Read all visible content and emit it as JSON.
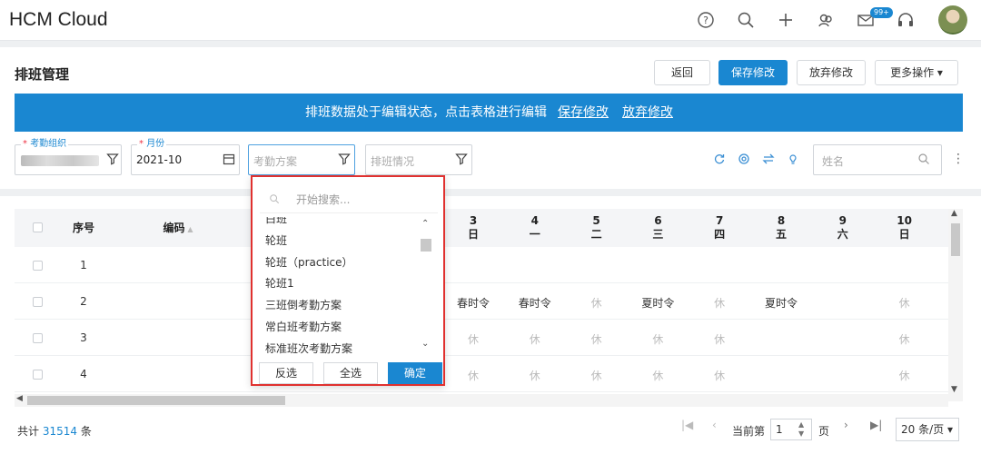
{
  "app": {
    "title": "HCM Cloud",
    "notification_badge": "99+"
  },
  "page": {
    "title": "排班管理"
  },
  "toolbar": {
    "back": "返回",
    "save": "保存修改",
    "discard": "放弃修改",
    "more": "更多操作 ▾"
  },
  "banner": {
    "message": "排班数据处于编辑状态，点击表格进行编辑",
    "save_link": "保存修改",
    "discard_link": "放弃修改"
  },
  "filters": {
    "org": {
      "label": "考勤组织",
      "value": ""
    },
    "month": {
      "label": "月份",
      "value": "2021-10"
    },
    "plan": {
      "placeholder": "考勤方案"
    },
    "status": {
      "placeholder": "排班情况"
    },
    "name": {
      "placeholder": "姓名"
    }
  },
  "table": {
    "headers": {
      "index": "序号",
      "code": "编码"
    },
    "days": [
      {
        "num": "3",
        "wd": "日"
      },
      {
        "num": "4",
        "wd": "一"
      },
      {
        "num": "5",
        "wd": "二"
      },
      {
        "num": "6",
        "wd": "三"
      },
      {
        "num": "7",
        "wd": "四"
      },
      {
        "num": "8",
        "wd": "五"
      },
      {
        "num": "9",
        "wd": "六"
      },
      {
        "num": "10",
        "wd": "日"
      }
    ],
    "rows": [
      {
        "index": "1",
        "cells": [
          "",
          "",
          "",
          "",
          "",
          "",
          "",
          ""
        ]
      },
      {
        "index": "2",
        "cells": [
          "春时令",
          "春时令",
          "休",
          "夏时令",
          "休",
          "夏时令",
          "",
          "休"
        ]
      },
      {
        "index": "3",
        "cells": [
          "休",
          "休",
          "休",
          "休",
          "休",
          "",
          "",
          "休"
        ]
      },
      {
        "index": "4",
        "cells": [
          "休",
          "休",
          "休",
          "休",
          "休",
          "",
          "",
          "休"
        ]
      }
    ]
  },
  "dropdown": {
    "search_placeholder": "开始搜索...",
    "items": [
      "白班",
      "轮班",
      "轮班（practice）",
      "轮班1",
      "三班倒考勤方案",
      "常白班考勤方案",
      "标准班次考勤方案"
    ],
    "invert": "反选",
    "select_all": "全选",
    "confirm": "确定"
  },
  "footer": {
    "total_prefix": "共计",
    "total": "31514",
    "total_suffix": "条",
    "current_label": "当前第",
    "page": "1",
    "page_suffix": "页",
    "page_size": "20 条/页 ▾"
  }
}
